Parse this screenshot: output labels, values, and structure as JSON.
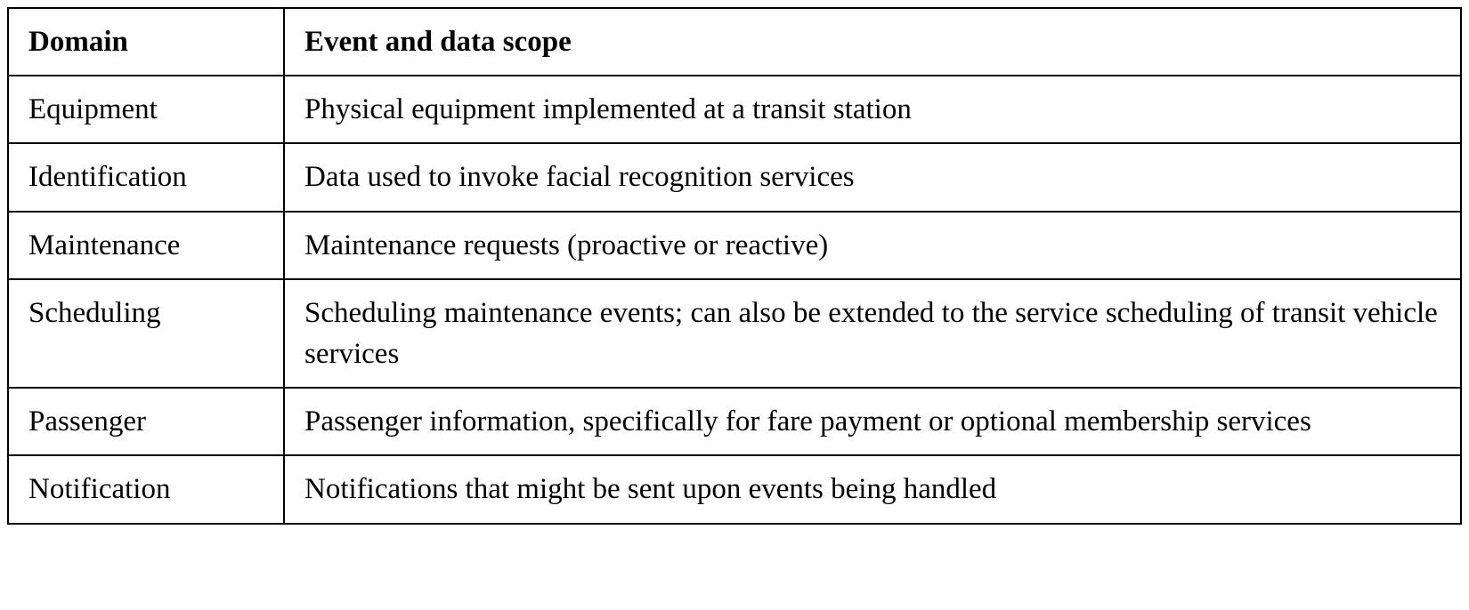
{
  "table": {
    "headers": {
      "domain": "Domain",
      "scope": "Event and data scope"
    },
    "rows": [
      {
        "domain": "Equipment",
        "scope": "Physical equipment implemented at a transit station"
      },
      {
        "domain": "Identification",
        "scope": "Data used to invoke facial recognition services"
      },
      {
        "domain": "Maintenance",
        "scope": "Maintenance requests (proactive or reactive)"
      },
      {
        "domain": "Scheduling",
        "scope": "Scheduling maintenance events; can also be extended to the service scheduling of transit vehicle services"
      },
      {
        "domain": "Passenger",
        "scope": "Passenger information, specifically for fare payment or optional membership services"
      },
      {
        "domain": "Notification",
        "scope": "Notifications that might be sent upon events being handled"
      }
    ]
  }
}
